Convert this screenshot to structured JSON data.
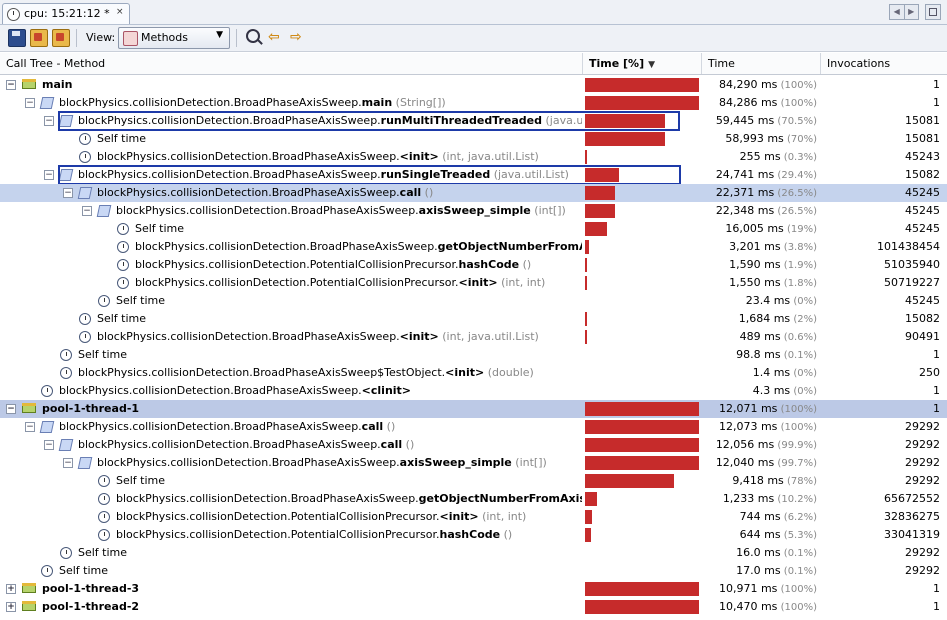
{
  "tab": {
    "title": "cpu: 15:21:12 *",
    "close": "×"
  },
  "toolbar": {
    "view_label": "View:",
    "view_value": "Methods"
  },
  "columns": [
    {
      "label": "Call Tree - Method"
    },
    {
      "label": "Time [%]",
      "sort": "▼"
    },
    {
      "label": "Time"
    },
    {
      "label": "Invocations"
    }
  ],
  "rows": [
    {
      "level": 0,
      "kind": "thread",
      "toggle": "−",
      "parts": [
        {
          "t": "main",
          "b": true
        }
      ],
      "bar": 1.0,
      "time": "84,290 ms",
      "pct": "(100%)",
      "inv": "1"
    },
    {
      "level": 1,
      "kind": "method",
      "toggle": "−",
      "parts": [
        {
          "t": "blockPhysics.collisionDetection.BroadPhaseAxisSweep."
        },
        {
          "t": "main",
          "b": true
        },
        {
          "t": " (String[])",
          "g": true
        }
      ],
      "bar": 1.0,
      "time": "84,286 ms",
      "pct": "(100%)",
      "inv": "1"
    },
    {
      "level": 2,
      "kind": "method",
      "toggle": "−",
      "parts": [
        {
          "t": "blockPhysics.collisionDetection.BroadPhaseAxisSweep."
        },
        {
          "t": "runMultiThreadedTreaded",
          "b": true
        },
        {
          "t": " (java.util.List)",
          "g": true
        }
      ],
      "bar": 0.705,
      "time": "59,445 ms",
      "pct": "(70.5%)",
      "inv": "15081",
      "boxed": true
    },
    {
      "level": 3,
      "kind": "self",
      "parts": [
        {
          "t": "Self time"
        }
      ],
      "bar": 0.7,
      "time": "58,993 ms",
      "pct": "(70%)",
      "inv": "15081"
    },
    {
      "level": 3,
      "kind": "self",
      "parts": [
        {
          "t": "blockPhysics.collisionDetection.BroadPhaseAxisSweep."
        },
        {
          "t": "<init>",
          "b": true
        },
        {
          "t": " (int, java.util.List)",
          "g": true
        }
      ],
      "bar": 0.003,
      "time": "255 ms",
      "pct": "(0.3%)",
      "inv": "45243"
    },
    {
      "level": 2,
      "kind": "method",
      "toggle": "−",
      "parts": [
        {
          "t": "blockPhysics.collisionDetection.BroadPhaseAxisSweep."
        },
        {
          "t": "runSingleTreaded",
          "b": true
        },
        {
          "t": " (java.util.List)",
          "g": true
        }
      ],
      "bar": 0.294,
      "time": "24,741 ms",
      "pct": "(29.4%)",
      "inv": "15082",
      "boxed": true
    },
    {
      "level": 3,
      "kind": "method",
      "toggle": "−",
      "parts": [
        {
          "t": "blockPhysics.collisionDetection.BroadPhaseAxisSweep."
        },
        {
          "t": "call",
          "b": true
        },
        {
          "t": " ()",
          "g": true
        }
      ],
      "bar": 0.265,
      "time": "22,371 ms",
      "pct": "(26.5%)",
      "inv": "45245",
      "sel": true
    },
    {
      "level": 4,
      "kind": "method",
      "toggle": "−",
      "parts": [
        {
          "t": "blockPhysics.collisionDetection.BroadPhaseAxisSweep."
        },
        {
          "t": "axisSweep_simple",
          "b": true
        },
        {
          "t": " (int[])",
          "g": true
        }
      ],
      "bar": 0.265,
      "time": "22,348 ms",
      "pct": "(26.5%)",
      "inv": "45245"
    },
    {
      "level": 5,
      "kind": "self",
      "parts": [
        {
          "t": "Self time"
        }
      ],
      "bar": 0.19,
      "time": "16,005 ms",
      "pct": "(19%)",
      "inv": "45245"
    },
    {
      "level": 5,
      "kind": "self",
      "parts": [
        {
          "t": "blockPhysics.collisionDetection.BroadPhaseAxisSweep."
        },
        {
          "t": "getObjectNumberFromAxisNumb",
          "b": true
        }
      ],
      "bar": 0.038,
      "time": "3,201 ms",
      "pct": "(3.8%)",
      "inv": "101438454"
    },
    {
      "level": 5,
      "kind": "self",
      "parts": [
        {
          "t": "blockPhysics.collisionDetection.PotentialCollisionPrecursor."
        },
        {
          "t": "hashCode",
          "b": true
        },
        {
          "t": " ()",
          "g": true
        }
      ],
      "bar": 0.019,
      "time": "1,590 ms",
      "pct": "(1.9%)",
      "inv": "51035940"
    },
    {
      "level": 5,
      "kind": "self",
      "parts": [
        {
          "t": "blockPhysics.collisionDetection.PotentialCollisionPrecursor."
        },
        {
          "t": "<init>",
          "b": true
        },
        {
          "t": " (int, int)",
          "g": true
        }
      ],
      "bar": 0.018,
      "time": "1,550 ms",
      "pct": "(1.8%)",
      "inv": "50719227"
    },
    {
      "level": 4,
      "kind": "self",
      "parts": [
        {
          "t": "Self time"
        }
      ],
      "bar": 0.0,
      "time": "23.4 ms",
      "pct": "(0%)",
      "inv": "45245"
    },
    {
      "level": 3,
      "kind": "self",
      "parts": [
        {
          "t": "Self time"
        }
      ],
      "bar": 0.02,
      "time": "1,684 ms",
      "pct": "(2%)",
      "inv": "15082"
    },
    {
      "level": 3,
      "kind": "self",
      "parts": [
        {
          "t": "blockPhysics.collisionDetection.BroadPhaseAxisSweep."
        },
        {
          "t": "<init>",
          "b": true
        },
        {
          "t": " (int, java.util.List)",
          "g": true
        }
      ],
      "bar": 0.006,
      "time": "489 ms",
      "pct": "(0.6%)",
      "inv": "90491"
    },
    {
      "level": 2,
      "kind": "self",
      "parts": [
        {
          "t": "Self time"
        }
      ],
      "bar": 0.0,
      "time": "98.8 ms",
      "pct": "(0.1%)",
      "inv": "1"
    },
    {
      "level": 2,
      "kind": "self",
      "parts": [
        {
          "t": "blockPhysics.collisionDetection.BroadPhaseAxisSweep$TestObject."
        },
        {
          "t": "<init>",
          "b": true
        },
        {
          "t": " (double)",
          "g": true
        }
      ],
      "bar": 0.0,
      "time": "1.4 ms",
      "pct": "(0%)",
      "inv": "250"
    },
    {
      "level": 1,
      "kind": "self",
      "parts": [
        {
          "t": "blockPhysics.collisionDetection.BroadPhaseAxisSweep."
        },
        {
          "t": "<clinit>",
          "b": true
        }
      ],
      "bar": 0.0,
      "time": "4.3 ms",
      "pct": "(0%)",
      "inv": "1"
    },
    {
      "level": 0,
      "kind": "thread",
      "toggle": "−",
      "parts": [
        {
          "t": "pool-1-thread-1",
          "b": true
        }
      ],
      "bar": 1.0,
      "time": "12,071 ms",
      "pct": "(100%)",
      "inv": "1",
      "hot": true
    },
    {
      "level": 1,
      "kind": "method",
      "toggle": "−",
      "parts": [
        {
          "t": "blockPhysics.collisionDetection.BroadPhaseAxisSweep."
        },
        {
          "t": "call",
          "b": true
        },
        {
          "t": " ()",
          "g": true
        }
      ],
      "bar": 1.0,
      "time": "12,073 ms",
      "pct": "(100%)",
      "inv": "29292"
    },
    {
      "level": 2,
      "kind": "method",
      "toggle": "−",
      "parts": [
        {
          "t": "blockPhysics.collisionDetection.BroadPhaseAxisSweep."
        },
        {
          "t": "call",
          "b": true
        },
        {
          "t": " ()",
          "g": true
        }
      ],
      "bar": 0.999,
      "time": "12,056 ms",
      "pct": "(99.9%)",
      "inv": "29292"
    },
    {
      "level": 3,
      "kind": "method",
      "toggle": "−",
      "parts": [
        {
          "t": "blockPhysics.collisionDetection.BroadPhaseAxisSweep."
        },
        {
          "t": "axisSweep_simple",
          "b": true
        },
        {
          "t": " (int[])",
          "g": true
        }
      ],
      "bar": 0.997,
      "time": "12,040 ms",
      "pct": "(99.7%)",
      "inv": "29292"
    },
    {
      "level": 4,
      "kind": "self",
      "parts": [
        {
          "t": "Self time"
        }
      ],
      "bar": 0.78,
      "time": "9,418 ms",
      "pct": "(78%)",
      "inv": "29292"
    },
    {
      "level": 4,
      "kind": "self",
      "parts": [
        {
          "t": "blockPhysics.collisionDetection.BroadPhaseAxisSweep."
        },
        {
          "t": "getObjectNumberFromAxisNumber",
          "b": true
        }
      ],
      "bar": 0.102,
      "time": "1,233 ms",
      "pct": "(10.2%)",
      "inv": "65672552"
    },
    {
      "level": 4,
      "kind": "self",
      "parts": [
        {
          "t": "blockPhysics.collisionDetection.PotentialCollisionPrecursor."
        },
        {
          "t": "<init>",
          "b": true
        },
        {
          "t": " (int, int)",
          "g": true
        }
      ],
      "bar": 0.062,
      "time": "744 ms",
      "pct": "(6.2%)",
      "inv": "32836275"
    },
    {
      "level": 4,
      "kind": "self",
      "parts": [
        {
          "t": "blockPhysics.collisionDetection.PotentialCollisionPrecursor."
        },
        {
          "t": "hashCode",
          "b": true
        },
        {
          "t": " ()",
          "g": true
        }
      ],
      "bar": 0.053,
      "time": "644 ms",
      "pct": "(5.3%)",
      "inv": "33041319"
    },
    {
      "level": 2,
      "kind": "self",
      "parts": [
        {
          "t": "Self time"
        }
      ],
      "bar": 0.0,
      "time": "16.0 ms",
      "pct": "(0.1%)",
      "inv": "29292"
    },
    {
      "level": 1,
      "kind": "self",
      "parts": [
        {
          "t": "Self time"
        }
      ],
      "bar": 0.0,
      "time": "17.0 ms",
      "pct": "(0.1%)",
      "inv": "29292"
    },
    {
      "level": 0,
      "kind": "thread",
      "toggle": "+",
      "parts": [
        {
          "t": "pool-1-thread-3",
          "b": true
        }
      ],
      "bar": 1.0,
      "time": "10,971 ms",
      "pct": "(100%)",
      "inv": "1"
    },
    {
      "level": 0,
      "kind": "thread",
      "toggle": "+",
      "parts": [
        {
          "t": "pool-1-thread-2",
          "b": true
        }
      ],
      "bar": 1.0,
      "time": "10,470 ms",
      "pct": "(100%)",
      "inv": "1"
    }
  ]
}
